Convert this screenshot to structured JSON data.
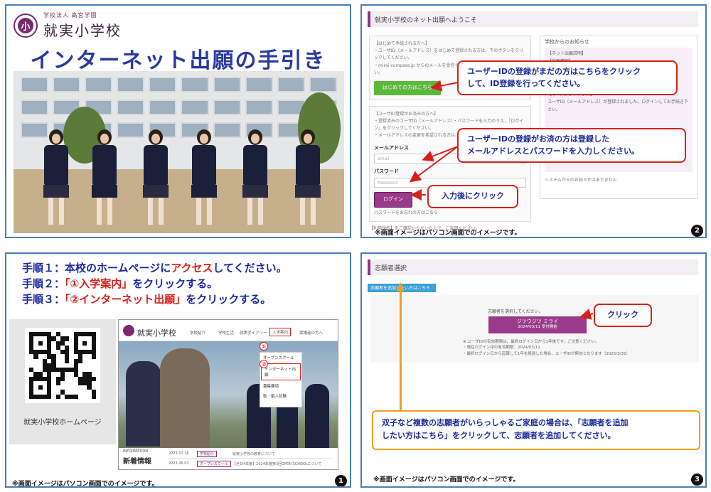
{
  "panel1": {
    "school_sub": "学校法人 高宮学園",
    "school_name": "就実小学校",
    "crest_char": "小",
    "title": "インターネット出願の手引き"
  },
  "panel2": {
    "header": "就実小学校のネット出願へようこそ",
    "left_info_title": "【はじめて手続される方へ】",
    "left_info_lines": [
      "・ユーザID（メールアドレス）をはじめて登録される方は、下のボタンをクリックしてください。",
      "・mirai-compass.jp からのメールを受信できるようドメイン指定してください。"
    ],
    "first_time_button": "はじめての方はこちら",
    "login_info_title": "【ユーザID登録がお済みの方へ】",
    "login_info_lines": [
      "・登録済みのユーザID（メールアドレス）・パスワードを入力のうえ、「ログイン」をクリックしてください。",
      "・メールアドレスの変更を希望される方は、ログイン後に変更してください。"
    ],
    "email_label": "メールアドレス",
    "email_placeholder": "email",
    "password_label": "パスワード",
    "password_placeholder": "Password",
    "login_button": "ログイン",
    "forgot_text": "パスワードをお忘れの方はこちら",
    "footer_text": "【利用規約】をご確認いただいた上で、ご利用ください。",
    "right_title": "学校からのお知らせ",
    "right_lines": [
      "【ネット出願説明】",
      "【最新情報】",
      "【サーバメンテナンス】",
      "ユーザID（メールアドレス）が登録されました。ログインしてお手続き下さい。",
      "システムからのお知らせはありません"
    ],
    "callout1_line1": "ユーザーIDの登録がまだの方はこちらをクリック",
    "callout1_line2": "して、ID登録を行ってください。",
    "callout2_line1": "ユーザーIDの登録がお済の方は登録した",
    "callout2_line2": "メールアドレスとパスワードを入力しください。",
    "callout3": "入力後にクリック",
    "note": "※画面イメージはパソコン画面でのイメージです。",
    "badge": "2"
  },
  "panel3": {
    "step1_prefix": "手順１：本校のホームページに",
    "step1_red": "アクセス",
    "step1_suffix": "してください。",
    "step2_prefix": "手順２：",
    "step2_red": "「①入学案内」",
    "step2_suffix": "をクリックする。",
    "step3_prefix": "手順３：",
    "step3_red": "「②インターネット出願」",
    "step3_suffix": "をクリックする。",
    "qr_caption": "就実小学校ホームページ",
    "hp_name": "就実小学校",
    "hp_menu": [
      "学校紹介",
      "学校生活",
      "就実ダイアリー",
      "入学案内",
      "保護者の方へ"
    ],
    "hp_dropdown": [
      "オープンスクール",
      "インターネット出願",
      "募集要項",
      "転・編入試験"
    ],
    "circle1": "①",
    "circle2": "②",
    "hp_info_label": "INFORMATION",
    "hp_info_big": "新着情報",
    "hp_news": [
      {
        "date": "2023.07.26",
        "tag": "学校紹介",
        "text": "就実小学校の教育について"
      },
      {
        "date": "2023.06.01",
        "tag": "オープンスクール",
        "text": "【全日4年度】2024年度第3回OPEN SCHOOLについて"
      }
    ],
    "note": "※画面イメージはパソコン画面でのイメージです。",
    "badge": "1"
  },
  "panel4": {
    "header": "志願者選択",
    "add_button": "志願者を追加したい方はこちら",
    "select_text": "志願者を選択してください。",
    "applicant_name": "ジツウジツ ミライ",
    "applicant_date": "2024/03/11 受付開始",
    "notes": [
      "※ ユーザIDの有効期限は、最終ログイン日から1年後です。ご注意ください。",
      "・現在ログイン中の有効期限：2024/03/11",
      "・最終ログイン日から起算して1年を経過した場合、ユーザIDが無効となります（2025/3/31）"
    ],
    "callout_click": "クリック",
    "orange_line1": "双子など複数の志願者がいらっしゃるご家庭の場合は、「志願者を追加",
    "orange_line2": "したい方はこちら」をクリックして、志願者を追加してください。",
    "note": "※画面イメージはパソコン画面でのイメージです。",
    "badge": "3"
  }
}
